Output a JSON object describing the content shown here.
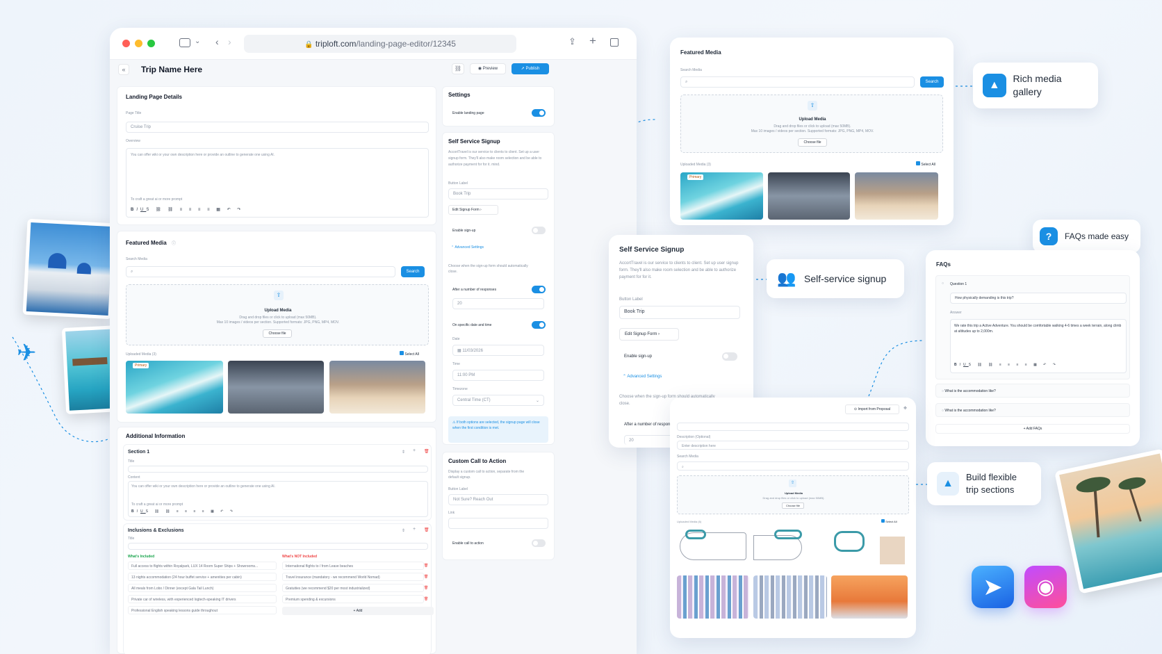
{
  "browser": {
    "url_host": "triploft.com",
    "url_path": "/landing-page-editor/12345"
  },
  "editor": {
    "trip_name": "Trip Name Here",
    "preview_label": "Preview",
    "publish_label": "Publish",
    "details": {
      "title": "Landing Page Details",
      "page_title_label": "Page Title",
      "page_title_value": "Cruise Trip",
      "overview_label": "Overview",
      "overview_placeholder": "You can offer wiki or your own description here or provide an outline to generate one using AI.",
      "ai_hint": "To craft a great ai or more prompt"
    },
    "media": {
      "title": "Featured Media",
      "search_label": "Search Media",
      "search_button": "Search",
      "upload_title": "Upload Media",
      "upload_hint": "Drag and drop files or click to upload (max 50MB).",
      "upload_formats": "Max 10 images / videos per section. Supported formats: JPG, PNG, MP4, MOV.",
      "choose_file": "Choose file",
      "uploaded_label": "Uploaded Media (3)",
      "select_all": "Select All",
      "primary_badge": "Primary"
    },
    "additional": {
      "title": "Additional Information",
      "section1": "Section 1",
      "title_label": "Title",
      "content_label": "Content",
      "content_placeholder": "You can offer wiki or your own description here or provide an outline to generate one using AI.",
      "ai_hint": "To craft a great ai or more prompt",
      "inclusions_title": "Inclusions & Exclusions",
      "included_label": "What's Included",
      "not_included_label": "What's NOT Included",
      "included": [
        "Full access to flights within Royalpark, LUX 14 Room Super Ships + Showrooms...",
        "13 nights accommodation (24 hour buffet service + amenities per cabin)",
        "All meals from Lobo / Dinner (except Gala Tail Lunch)",
        "Private car of wireless, with experienced logtech-speaking IT drivers",
        "Professional English speaking lessons guide throughout"
      ],
      "not_included": [
        "International flights to / from Leave beaches",
        "Travel insurance (mandatory - we recommend World Nomad)",
        "Gratuities (we recommend $20 per most industrialized)",
        "Premium spending & excursions"
      ],
      "add_label": "+ Add"
    },
    "settings": {
      "title": "Settings",
      "enable_landing": "Enable landing page"
    },
    "signup": {
      "title": "Self Service Signup",
      "desc": "AccortTravel is our service to clients to client. Set up a user signup form. They'll also make room selection and be able to authorize payment for for it. mind.",
      "button_label": "Button Label",
      "button_value": "Book Trip",
      "edit_form": "Edit Signup Form",
      "enable_signup": "Enable sign-up",
      "advanced": "Advanced Settings",
      "choose_close": "Choose when the sign-up form should automatically close.",
      "after_responses": "After a number of responses",
      "responses_value": "20",
      "on_date": "On specific date and time",
      "date_label": "Date",
      "date_value": "11/03/2026",
      "time_label": "Time",
      "time_value": "11:00 PM",
      "timezone_label": "Timezone",
      "timezone_value": "Central Time (CT)",
      "note": "If both options are selected, the signup page will close when the first condition is met."
    },
    "cta": {
      "title": "Custom Call to Action",
      "desc": "Display a custom call to action, separate from the default signup.",
      "button_label": "Button Label",
      "button_value": "Not Sure? Reach Out",
      "link_label": "Link",
      "enable": "Enable call to action"
    }
  },
  "rich_media_card": {
    "title": "Featured Media",
    "search_label": "Search Media",
    "search_button": "Search",
    "upload_title": "Upload Media",
    "upload_hint": "Drag and drop files or click to upload (max 50MB).",
    "upload_formats": "Max 10 images / videos per section. Supported formats: JPG, PNG, MP4, MOV.",
    "choose_file": "Choose file",
    "uploaded_label": "Uploaded Media (3)",
    "select_all": "Select All",
    "primary_badge": "Primary"
  },
  "signup_card": {
    "title": "Self Service Signup",
    "desc": "AccortTravel is our service to clients to client. Set up user signup form. They'll also make room selection and be able to authorize payment for for it.",
    "button_label": "Button Label",
    "button_value": "Book Trip",
    "edit_form": "Edit Signup Form",
    "enable_signup": "Enable sign-up",
    "advanced": "Advanced Settings",
    "choose_close": "Choose when the sign-up form should automatically close.",
    "after_responses": "After a number of responses",
    "responses_value": "20"
  },
  "faq_card": {
    "title": "FAQs",
    "q1_label": "Question 1",
    "q1_value": "How physically demanding is this trip?",
    "answer_label": "Answer",
    "answer_value": "We rate this trip a Active Adventure. You should be comfortable walking 4-6 times a week terrain, along climb at altitudes up to 2,000m.",
    "q2": "What is the accommodation like?",
    "q3": "What is the accommodation like?",
    "add_faqs": "+ Add FAQs"
  },
  "sections_card": {
    "import_label": "Import from Proposal",
    "desc_label": "Description (Optional)",
    "desc_placeholder": "Enter description here",
    "search_label": "Search Media",
    "upload_title": "Upload Media",
    "upload_hint": "Drag and drop files or click to upload (max 50MB).",
    "choose_file": "Choose file",
    "uploaded_label": "Uploaded Media (6)",
    "select_all": "Select All"
  },
  "features": {
    "rich_media": "Rich media gallery",
    "faqs": "FAQs made easy",
    "self_service": "Self-service signup",
    "flexible": "Build flexible trip sections"
  },
  "colors": {
    "accent": "#1a8fe3",
    "danger": "#ef4444",
    "included": "#16a34a"
  }
}
